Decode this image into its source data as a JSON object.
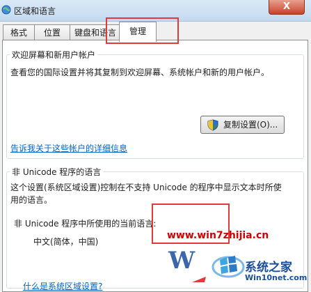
{
  "window": {
    "title": "区域和语言",
    "close_label": "X"
  },
  "tabs": [
    {
      "label": "格式"
    },
    {
      "label": "位置"
    },
    {
      "label": "键盘和语言"
    },
    {
      "label": "管理"
    }
  ],
  "welcome_group": {
    "legend": "欢迎屏幕和新用户帐户",
    "description": "查看您的国际设置并将其复制到欢迎屏幕、系统帐户和新的用户帐户。",
    "copy_button_label": "复制设置(O)...",
    "link": "告诉我关于这些帐户的详细信息"
  },
  "unicode_group": {
    "legend": "非 Unicode 程序的语言",
    "description_line1": "这个设置(系统区域设置)控制在不支持 Unicode 的程序中显示文本时所使",
    "description_line2": "用的语言。",
    "current_label": "非 Unicode 程序中所使用的当前语言:",
    "current_value": "中文(简体，中国)",
    "link": "什么是系统区域设置?"
  },
  "watermark": {
    "url": "www.win7zhijia.cn",
    "brand": "系统之家",
    "domain": "Win10net.com"
  },
  "colors": {
    "annotation_red": "#e03a3a",
    "link_blue": "#0066cc"
  }
}
